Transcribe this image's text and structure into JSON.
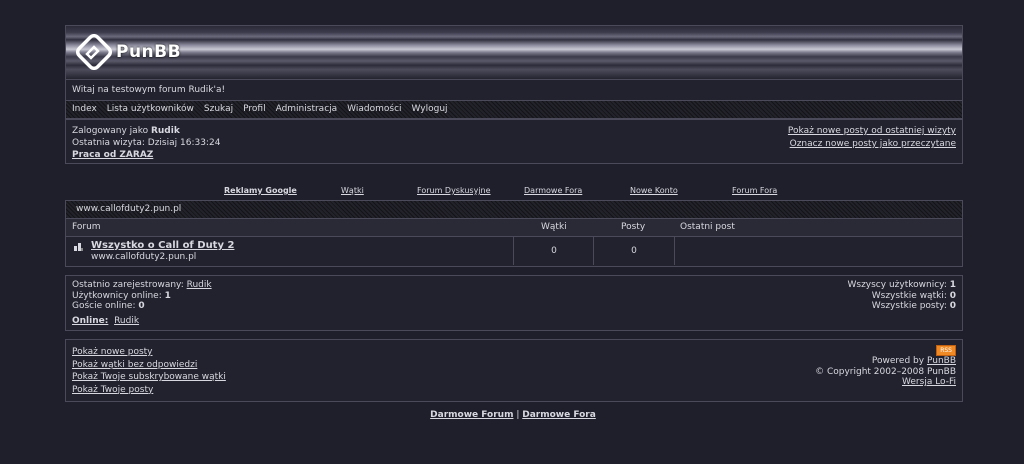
{
  "header": {
    "logo_text": "PunBB",
    "welcome": "Witaj na testowym forum Rudik'a!"
  },
  "nav": [
    "Index",
    "Lista użytkowników",
    "Szukaj",
    "Profil",
    "Administracja",
    "Wiadomości",
    "Wyloguj"
  ],
  "userbox": {
    "logged_label": "Zalogowany jako",
    "username": "Rudik",
    "last_visit": "Ostatnia wizyta: Dzisiaj 16:33:24",
    "job_link": "Praca od ZARAZ",
    "new_posts_link": "Pokaż nowe posty od ostatniej wizyty",
    "mark_read_link": "Oznacz nowe posty jako przeczytane"
  },
  "ads": [
    "Reklamy Google",
    "Wątki",
    "Forum Dyskusyjne",
    "Darmowe Fora",
    "Nowe Konto",
    "Forum Fora"
  ],
  "forum": {
    "category": "www.callofduty2.pun.pl",
    "col_forum": "Forum",
    "col_topics": "Wątki",
    "col_posts": "Posty",
    "col_last": "Ostatni post",
    "row_title": "Wszystko o Call of Duty 2",
    "row_desc": "www.callofduty2.pun.pl",
    "row_topics": "0",
    "row_posts": "0"
  },
  "stats": {
    "last_registered_label": "Ostatnio zarejestrowany:",
    "last_registered": "Rudik",
    "users_online_label": "Użytkownicy online:",
    "users_online": "1",
    "guests_online_label": "Goście online:",
    "guests_online": "0",
    "online_label": "Online:",
    "online_user": "Rudik",
    "total_users_label": "Wszyscy użytkownicy:",
    "total_users": "1",
    "total_topics_label": "Wszystkie wątki:",
    "total_topics": "0",
    "total_posts_label": "Wszystkie posty:",
    "total_posts": "0"
  },
  "footer": {
    "links": [
      "Pokaż nowe posty",
      "Pokaż wątki bez odpowiedzi",
      "Pokaż Twoje subskrybowane wątki",
      "Pokaż Twoje posty"
    ],
    "rss": "RSS",
    "powered_by": "Powered by",
    "punbb": "PunBB",
    "copyright": "© Copyright 2002–2008 PunBB",
    "lofi": "Wersja Lo-Fi"
  },
  "bottom": {
    "link1": "Darmowe Forum",
    "sep": "|",
    "link2": "Darmowe Fora"
  }
}
